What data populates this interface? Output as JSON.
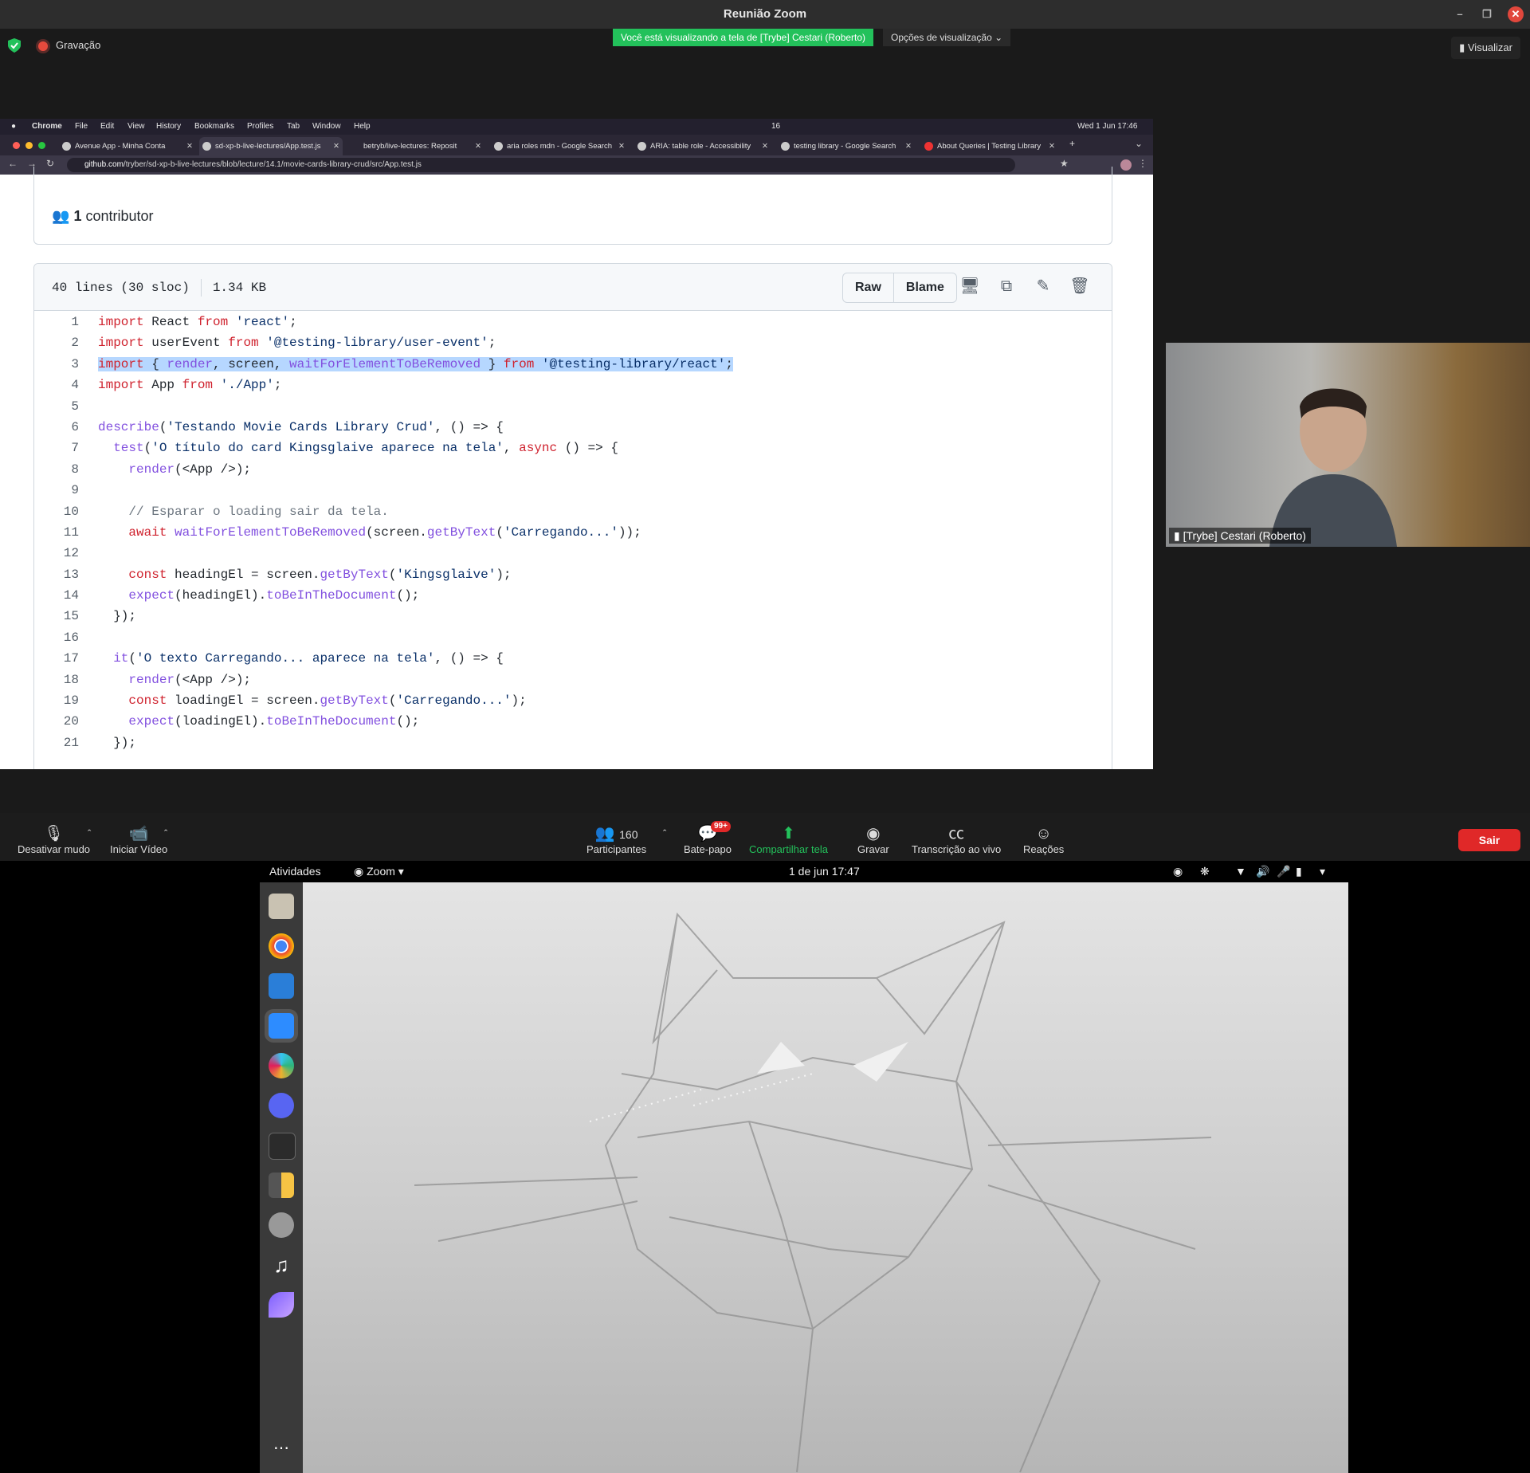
{
  "zoom": {
    "title": "Reunião Zoom",
    "recording_label": "Gravação",
    "viewing_banner": "Você está visualizando a tela de [Trybe] Cestari (Roberto)",
    "view_options": "Opções de visualização",
    "view_button": "Visualizar",
    "participant_name": "[Trybe] Cestari (Roberto)",
    "controls": {
      "mute": "Desativar mudo",
      "video": "Iniciar Vídeo",
      "participants": "Participantes",
      "participants_count": "160",
      "chat": "Bate-papo",
      "chat_badge": "99+",
      "share": "Compartilhar tela",
      "record": "Gravar",
      "transcription": "Transcrição ao vivo",
      "reactions": "Reações",
      "leave": "Sair"
    }
  },
  "mac": {
    "menu": [
      "Chrome",
      "File",
      "Edit",
      "View",
      "History",
      "Bookmarks",
      "Profiles",
      "Tab",
      "Window",
      "Help"
    ],
    "status_badge": "16",
    "clock": "Wed 1 Jun  17:46"
  },
  "chrome": {
    "tabs": [
      {
        "title": "Avenue App - Minha Conta"
      },
      {
        "title": "sd-xp-b-live-lectures/App.test.js"
      },
      {
        "title": "betryb/live-lectures: Reposit"
      },
      {
        "title": "aria roles mdn - Google Search"
      },
      {
        "title": "ARIA: table role - Accessibility"
      },
      {
        "title": "testing library - Google Search"
      },
      {
        "title": "About Queries | Testing Library"
      }
    ],
    "url_host": "github.com",
    "url_path": "/tryber/sd-xp-b-live-lectures/blob/lecture/14.1/movie-cards-library-crud/src/App.test.js"
  },
  "github": {
    "contributors_count": "1",
    "contributors_label": "contributor",
    "file_lines": "40 lines (30 sloc)",
    "file_size": "1.34 KB",
    "raw_label": "Raw",
    "blame_label": "Blame",
    "code": [
      {
        "n": "1",
        "text": "import React from 'react';"
      },
      {
        "n": "2",
        "text": "import userEvent from '@testing-library/user-event';"
      },
      {
        "n": "3",
        "text": "import { render, screen, waitForElementToBeRemoved } from '@testing-library/react';"
      },
      {
        "n": "4",
        "text": "import App from './App';"
      },
      {
        "n": "5",
        "text": ""
      },
      {
        "n": "6",
        "text": "describe('Testando Movie Cards Library Crud', () => {"
      },
      {
        "n": "7",
        "text": "  test('O título do card Kingsglaive aparece na tela', async () => {"
      },
      {
        "n": "8",
        "text": "    render(<App />);"
      },
      {
        "n": "9",
        "text": ""
      },
      {
        "n": "10",
        "text": "    // Esparar o loading sair da tela."
      },
      {
        "n": "11",
        "text": "    await waitForElementToBeRemoved(screen.getByText('Carregando...'));"
      },
      {
        "n": "12",
        "text": ""
      },
      {
        "n": "13",
        "text": "    const headingEl = screen.getByText('Kingsglaive');"
      },
      {
        "n": "14",
        "text": "    expect(headingEl).toBeInTheDocument();"
      },
      {
        "n": "15",
        "text": "  });"
      },
      {
        "n": "16",
        "text": ""
      },
      {
        "n": "17",
        "text": "  it('O texto Carregando... aparece na tela', () => {"
      },
      {
        "n": "18",
        "text": "    render(<App />);"
      },
      {
        "n": "19",
        "text": "    const loadingEl = screen.getByText('Carregando...');"
      },
      {
        "n": "20",
        "text": "    expect(loadingEl).toBeInTheDocument();"
      },
      {
        "n": "21",
        "text": "  });"
      }
    ]
  },
  "ubuntu": {
    "activities": "Atividades",
    "app_name": "Zoom",
    "datetime": "1 de jun  17:47"
  },
  "colors": {
    "banner_green": "#23c15b",
    "leave_red": "#e02828",
    "selection": "#b6d7ff",
    "keyword": "#cf222e",
    "string": "#0a3069",
    "function": "#8250df",
    "comment": "#6e7781"
  }
}
